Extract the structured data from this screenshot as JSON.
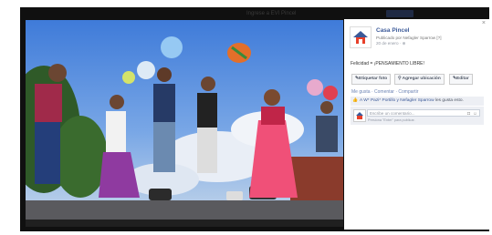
{
  "topbar": {
    "search_text": "Ingrese a EVI Pincel",
    "user_label": ""
  },
  "side": {
    "close": "×",
    "page_name": "Casa Pincel",
    "published_by": "Publicado por Nefagler Sparrow [?]",
    "date": "20 de enero · ⊕",
    "caption": "Felicidad = ¡PENSAMIENTO LIBRE!",
    "buttons": {
      "tag": "✎Etiquetar foto",
      "location": "⚲ Agregar ubicación",
      "edit": "✎Editar"
    },
    "actions": "Me gusta · Comentar · Compartir",
    "likes": {
      "thumb": "👍",
      "names": "A W* Pazi* Portillo y Nefagler Sparrow",
      "suffix": " les gusta esto."
    },
    "comment": {
      "placeholder": "Escribe un comentario...",
      "hint": "Presiona \"Enter\" para publicar.",
      "camera": "◘",
      "smile": "☺"
    }
  },
  "colors": {
    "link": "#3b5998",
    "overlay": "#101010",
    "sky": "#5f93dd",
    "road": "#5a5a5e"
  }
}
